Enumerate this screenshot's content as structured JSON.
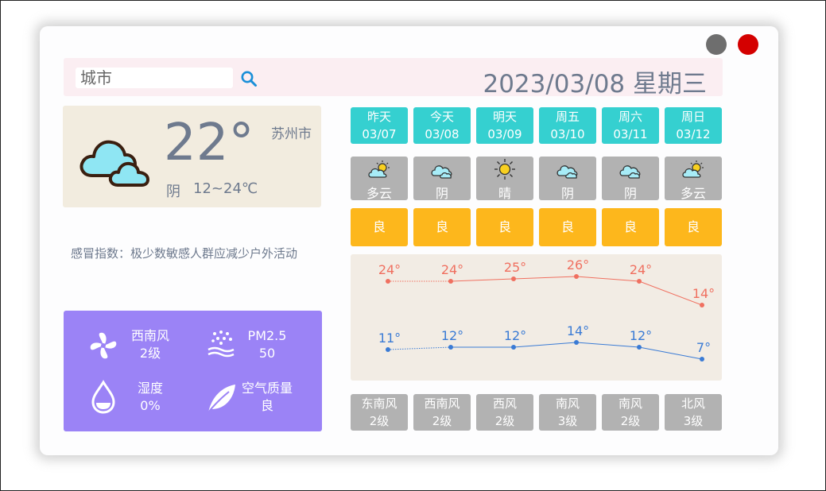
{
  "window": {
    "minimize_label": "",
    "close_label": ""
  },
  "search": {
    "placeholder": "城市"
  },
  "date": {
    "text": "2023/03/08 星期三"
  },
  "today": {
    "temp": "22°",
    "city": "苏州市",
    "condition": "阴",
    "range": "12~24℃",
    "icon": "cloud-icon"
  },
  "cold_index": "感冒指数：极少数敏感人群应减少户外活动",
  "stats": {
    "wind_dir": "西南风",
    "wind_level": "2级",
    "pm_label": "PM2.5",
    "pm_value": "50",
    "humidity_label": "湿度",
    "humidity_value": "0%",
    "aq_label": "空气质量",
    "aq_value": "良"
  },
  "forecast": [
    {
      "day": "昨天",
      "date": "03/07",
      "condition": "多云",
      "icon": "partly-cloudy-icon",
      "aq": "良",
      "wind": "东南风",
      "level": "2级"
    },
    {
      "day": "今天",
      "date": "03/08",
      "condition": "阴",
      "icon": "cloud-icon",
      "aq": "良",
      "wind": "西南风",
      "level": "2级"
    },
    {
      "day": "明天",
      "date": "03/09",
      "condition": "晴",
      "icon": "sun-icon",
      "aq": "良",
      "wind": "西风",
      "level": "2级"
    },
    {
      "day": "周五",
      "date": "03/10",
      "condition": "阴",
      "icon": "cloud-icon",
      "aq": "良",
      "wind": "南风",
      "level": "3级"
    },
    {
      "day": "周六",
      "date": "03/11",
      "condition": "阴",
      "icon": "cloud-icon",
      "aq": "良",
      "wind": "南风",
      "level": "2级"
    },
    {
      "day": "周日",
      "date": "03/12",
      "condition": "多云",
      "icon": "partly-cloudy-icon",
      "aq": "良",
      "wind": "北风",
      "level": "3级"
    }
  ],
  "colors": {
    "accent_cyan": "#35d0d0",
    "aq_yellow": "#fdb71c",
    "stats_purple": "#9b83f6",
    "high_line": "#f07060",
    "low_line": "#3a7bd5"
  },
  "chart_data": {
    "type": "line",
    "categories": [
      "03/07",
      "03/08",
      "03/09",
      "03/10",
      "03/11",
      "03/12"
    ],
    "series": [
      {
        "values": [
          24,
          24,
          25,
          26,
          24,
          14
        ],
        "color": "#f07060"
      },
      {
        "values": [
          11,
          12,
          12,
          14,
          12,
          7
        ],
        "color": "#3a7bd5"
      }
    ],
    "first_segment_dotted": true,
    "grid": false
  }
}
